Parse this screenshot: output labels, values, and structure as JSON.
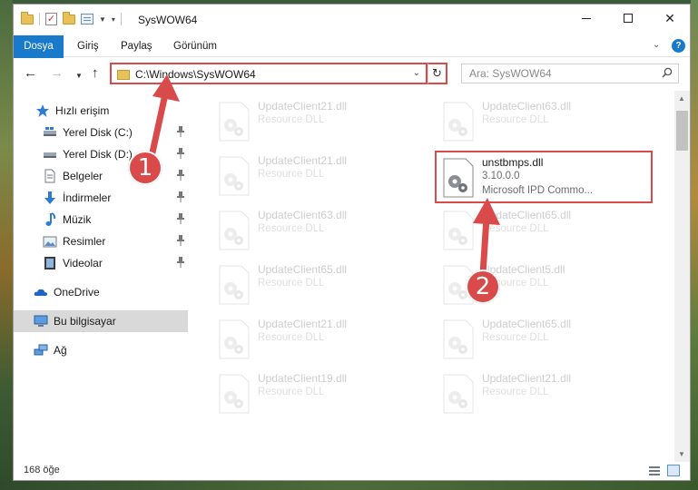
{
  "window": {
    "title": "SysWOW64"
  },
  "ribbon": {
    "tabs": [
      "Dosya",
      "Giriş",
      "Paylaş",
      "Görünüm"
    ]
  },
  "address": {
    "path": "C:\\Windows\\SysWOW64",
    "search_placeholder": "Ara: SysWOW64"
  },
  "nav": {
    "items": [
      {
        "label": "Hızlı erişim",
        "icon": "star-icon"
      },
      {
        "label": "Yerel Disk (C:)",
        "icon": "drive-icon"
      },
      {
        "label": "Yerel Disk (D:)",
        "icon": "drive-icon"
      },
      {
        "label": "Belgeler",
        "icon": "document-icon"
      },
      {
        "label": "İndirmeler",
        "icon": "download-icon"
      },
      {
        "label": "Müzik",
        "icon": "music-icon"
      },
      {
        "label": "Resimler",
        "icon": "picture-icon"
      },
      {
        "label": "Videolar",
        "icon": "video-icon"
      },
      {
        "label": "OneDrive",
        "icon": "cloud-icon"
      },
      {
        "label": "Bu bilgisayar",
        "icon": "computer-icon"
      },
      {
        "label": "Ağ",
        "icon": "network-icon"
      }
    ]
  },
  "files": [
    {
      "name": "UpdateClient21.dll",
      "desc": "Resource DLL"
    },
    {
      "name": "UpdateClient63.dll",
      "desc": "Resource DLL"
    },
    {
      "name": "UpdateClient21.dll",
      "desc": "Resource DLL"
    },
    {
      "name": "unstbmps.dll",
      "desc": "3.10.0.0",
      "desc2": "Microsoft IPD Commo..."
    },
    {
      "name": "UpdateClient63.dll",
      "desc": "Resource DLL"
    },
    {
      "name": "UpdateClient65.dll",
      "desc": "Resource DLL"
    },
    {
      "name": "UpdateClient65.dll",
      "desc": "Resource DLL"
    },
    {
      "name": "UpdateClient5.dll",
      "desc": "Resource DLL"
    },
    {
      "name": "UpdateClient21.dll",
      "desc": "Resource DLL"
    },
    {
      "name": "UpdateClient65.dll",
      "desc": "Resource DLL"
    },
    {
      "name": "UpdateClient19.dll",
      "desc": "Resource DLL"
    },
    {
      "name": "UpdateClient21.dll",
      "desc": "Resource DLL"
    }
  ],
  "status": {
    "count": "168 öğe"
  },
  "annotations": {
    "step1": "1",
    "step2": "2"
  },
  "colors": {
    "accent": "#1979ca",
    "annotation": "#d94a4a"
  }
}
